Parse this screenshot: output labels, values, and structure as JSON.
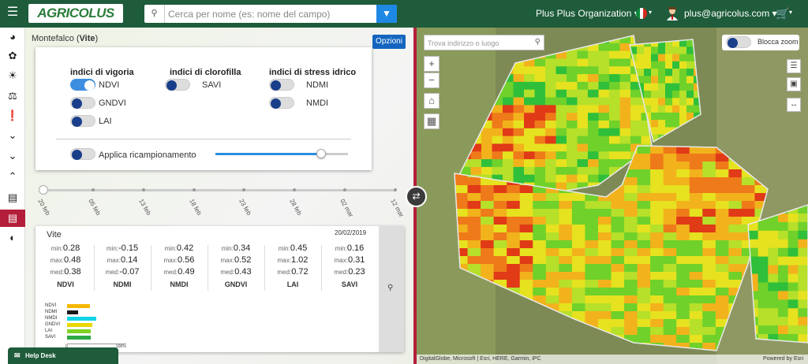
{
  "header": {
    "logo": "AGRICOLUS",
    "search_placeholder": "Cerca per nome (es: nome del campo)",
    "organization": "Plus Plus Organization ▾",
    "user_email": "plus@agricolus.com ▾",
    "caret": "▾"
  },
  "sidebar": {
    "items": [
      "dashboard-icon",
      "leaf-icon",
      "weather-icon",
      "flask-icon",
      "alert-icon",
      "chevron-down-icon",
      "chevron-down-icon",
      "chevron-up-icon",
      "bar-chart-icon",
      "bar-chart-icon",
      "bulb-icon"
    ]
  },
  "panel": {
    "field_name": "Montefalco",
    "crop": "Vite",
    "options_label": "Opzioni",
    "groups": [
      {
        "title": "indici di vigoria",
        "items": [
          {
            "label": "NDVI",
            "on": true
          },
          {
            "label": "GNDVI",
            "on": false
          },
          {
            "label": "LAI",
            "on": false
          }
        ]
      },
      {
        "title": "indici di clorofilla",
        "items": [
          {
            "label": "SAVI",
            "on": false
          }
        ]
      },
      {
        "title": "indici di stress idrico",
        "items": [
          {
            "label": "NDMI",
            "on": false
          },
          {
            "label": "NMDI",
            "on": false
          }
        ]
      }
    ],
    "resample_label": "Applica ricampionamento",
    "resample_on": false,
    "resample_value": 0.8
  },
  "timeline": {
    "dates": [
      "20 feb",
      "05 feb",
      "13 feb",
      "18 feb",
      "23 feb",
      "28 feb",
      "02 mar",
      "12 mar"
    ]
  },
  "stats": {
    "name": "Vite",
    "date": "20/02/2019",
    "columns": [
      {
        "name": "NDVI",
        "min": "0.28",
        "max": "0.48",
        "med": "0.38"
      },
      {
        "name": "NDMI",
        "min": "-0.15",
        "max": "0.14",
        "med": "-0.07"
      },
      {
        "name": "NMDI",
        "min": "0.42",
        "max": "0.56",
        "med": "0.49"
      },
      {
        "name": "GNDVI",
        "min": "0.34",
        "max": "0.52",
        "med": "0.43"
      },
      {
        "name": "LAI",
        "min": "0.45",
        "max": "1.02",
        "med": "0.72"
      },
      {
        "name": "SAVI",
        "min": "0.16",
        "max": "0.31",
        "med": "0.23"
      }
    ],
    "labels": {
      "min": "min:",
      "max": "max:",
      "med": "med:"
    },
    "mini_chart": {
      "bars": [
        {
          "label": "NDVI",
          "value": 0.38,
          "color": "#f5b800"
        },
        {
          "label": "NDMI",
          "value": 0.18,
          "color": "#1a1a1a"
        },
        {
          "label": "NMDI",
          "value": 0.49,
          "color": "#12d4e6"
        },
        {
          "label": "GNDVI",
          "value": 0.43,
          "color": "#e8d800"
        },
        {
          "label": "LAI",
          "value": 0.4,
          "color": "#7ed321"
        },
        {
          "label": "SAVI",
          "value": 0.4,
          "color": "#2eaa44"
        }
      ],
      "axis_min": "0",
      "axis_max": "100%"
    }
  },
  "helpdesk": "Help Desk",
  "map": {
    "search_placeholder": "Trova indirizzo o luogo",
    "lock_zoom_label": "Blocca zoom",
    "attribution": "DigitalGlobe, Microsoft | Esri, HERE, Garmin, iPC",
    "powered": "Powered by Esri"
  },
  "colors": {
    "brand": "#1e5c3b",
    "accent": "#1e88e5",
    "active": "#b31f3a"
  }
}
